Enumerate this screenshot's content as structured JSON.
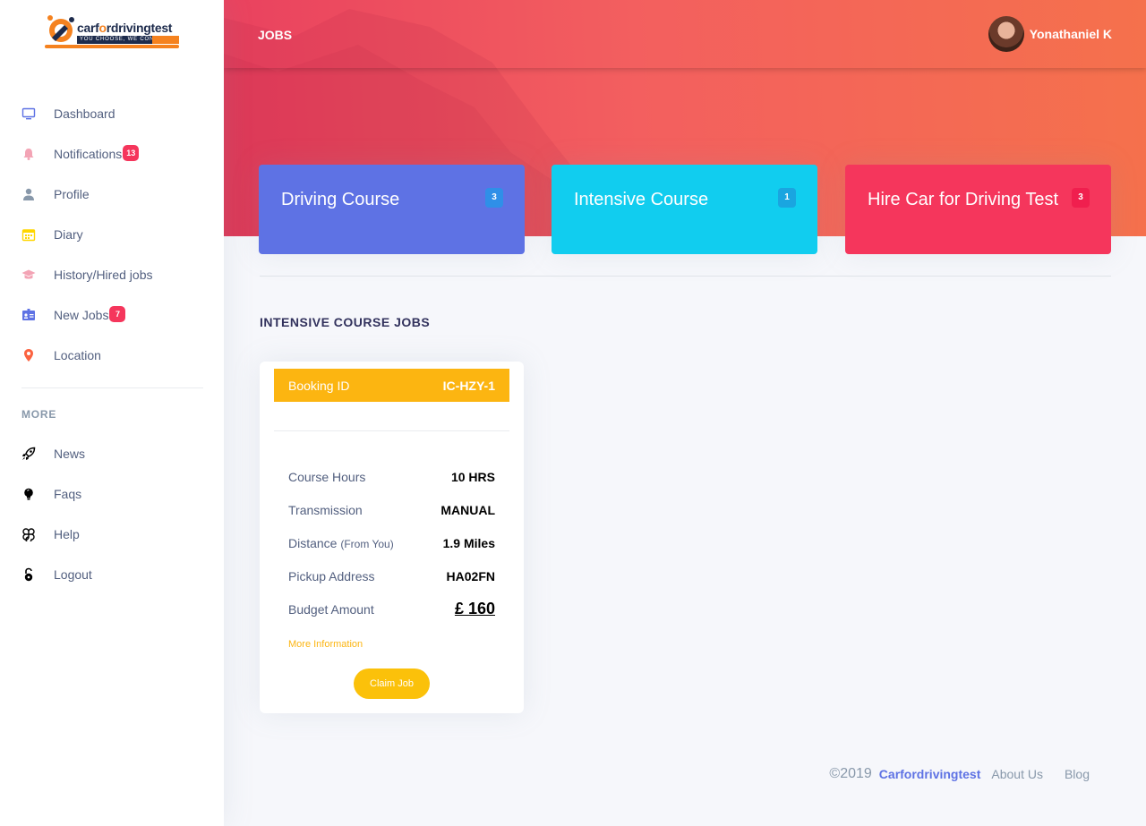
{
  "brand": {
    "logo_text_1": "carf",
    "logo_text_o": "o",
    "logo_text_2": "rdrivingtest",
    "tagline": "YOU CHOOSE, WE CONNECT"
  },
  "sidebar": {
    "items": [
      {
        "label": "Dashboard",
        "icon": "monitor-icon"
      },
      {
        "label": "Notifications",
        "icon": "bell-icon",
        "badge": "13"
      },
      {
        "label": "Profile",
        "icon": "user-icon"
      },
      {
        "label": "Diary",
        "icon": "calendar-icon"
      },
      {
        "label": "History/Hired jobs",
        "icon": "graduation-cap-icon"
      },
      {
        "label": "New Jobs",
        "icon": "id-card-icon",
        "badge": "7"
      },
      {
        "label": "Location",
        "icon": "map-pin-icon"
      }
    ],
    "more_heading": "MORE",
    "more_items": [
      {
        "label": "News",
        "icon": "rocket-icon"
      },
      {
        "label": "Faqs",
        "icon": "lightbulb-icon"
      },
      {
        "label": "Help",
        "icon": "command-icon"
      },
      {
        "label": "Logout",
        "icon": "unlock-icon"
      }
    ]
  },
  "header": {
    "title": "JOBS",
    "user_name": "Yonathaniel K"
  },
  "stats": [
    {
      "title": "Driving Course",
      "count": "3",
      "color": "#5e72e4"
    },
    {
      "title": "Intensive Course",
      "count": "1",
      "color": "#11cdef"
    },
    {
      "title": "Hire Car for Driving Test",
      "count": "3",
      "color": "#f5365c"
    }
  ],
  "section_title": "INTENSIVE COURSE JOBS",
  "job": {
    "booking_label": "Booking ID",
    "booking_id": "IC-HZY-1",
    "rows": [
      {
        "label": "Course Hours",
        "value": "10 HRS"
      },
      {
        "label": "Transmission",
        "value": "MANUAL"
      },
      {
        "label": "Distance",
        "sub": "(From You)",
        "value": "1.9 Miles"
      },
      {
        "label": "Pickup Address",
        "value": "HA02FN"
      },
      {
        "label": "Budget Amount",
        "value": "£ 160"
      }
    ],
    "more_info": "More Information",
    "claim_label": "Claim Job"
  },
  "footer": {
    "copyright": "©2019",
    "brand": "Carfordrivingtest",
    "links": [
      "About Us",
      "Blog"
    ]
  },
  "colors": {
    "accent": "#5e72e4",
    "warning": "#fcb511",
    "danger": "#f5365c",
    "info": "#11cdef"
  }
}
